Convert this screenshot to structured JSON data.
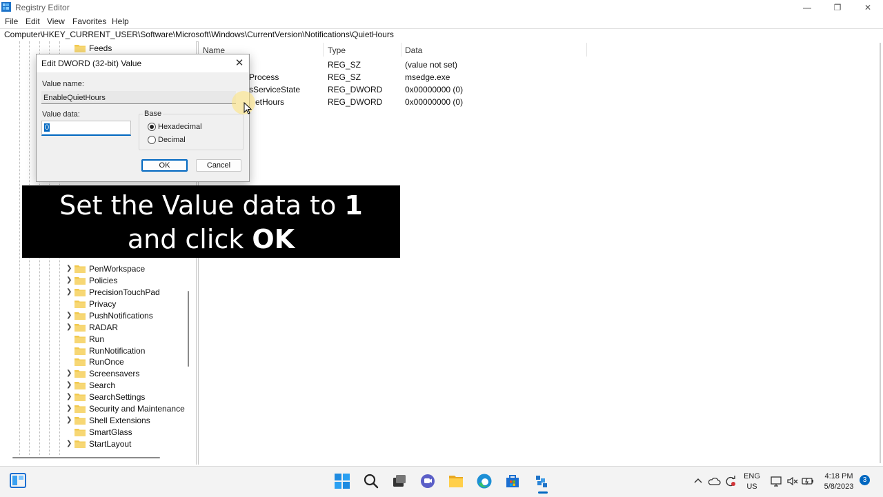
{
  "window": {
    "title": "Registry Editor",
    "controls": {
      "minimize": "—",
      "restore": "❐",
      "close": "✕"
    }
  },
  "menu": [
    "File",
    "Edit",
    "View",
    "Favorites",
    "Help"
  ],
  "address": "Computer\\HKEY_CURRENT_USER\\Software\\Microsoft\\Windows\\CurrentVersion\\Notifications\\QuietHours",
  "tree": {
    "top_item": "Feeds",
    "items": [
      {
        "label": "PenWorkspace",
        "expandable": true
      },
      {
        "label": "Policies",
        "expandable": true
      },
      {
        "label": "PrecisionTouchPad",
        "expandable": true
      },
      {
        "label": "Privacy",
        "expandable": false
      },
      {
        "label": "PushNotifications",
        "expandable": true
      },
      {
        "label": "RADAR",
        "expandable": true
      },
      {
        "label": "Run",
        "expandable": false
      },
      {
        "label": "RunNotification",
        "expandable": false
      },
      {
        "label": "RunOnce",
        "expandable": false
      },
      {
        "label": "Screensavers",
        "expandable": true
      },
      {
        "label": "Search",
        "expandable": true
      },
      {
        "label": "SearchSettings",
        "expandable": true
      },
      {
        "label": "Security and Maintenance",
        "expandable": true
      },
      {
        "label": "Shell Extensions",
        "expandable": true
      },
      {
        "label": "SmartGlass",
        "expandable": false
      },
      {
        "label": "StartLayout",
        "expandable": true
      }
    ]
  },
  "list": {
    "columns": {
      "name": "Name",
      "type": "Type",
      "data": "Data"
    },
    "rows": [
      {
        "name": "",
        "type": "REG_SZ",
        "data": "(value not set)"
      },
      {
        "name": "Process",
        "type": "REG_SZ",
        "data": "msedge.exe"
      },
      {
        "name": "sServiceState",
        "type": "REG_DWORD",
        "data": "0x00000000 (0)"
      },
      {
        "name": "etHours",
        "type": "REG_DWORD",
        "data": "0x00000000 (0)"
      }
    ]
  },
  "dialog": {
    "title": "Edit DWORD (32-bit) Value",
    "close": "✕",
    "value_name_label": "Value name:",
    "value_name": "EnableQuietHours",
    "value_data_label": "Value data:",
    "value_data": "0",
    "base_label": "Base",
    "base_options": [
      {
        "label": "Hexadecimal",
        "selected": true
      },
      {
        "label": "Decimal",
        "selected": false
      }
    ],
    "ok": "OK",
    "cancel": "Cancel"
  },
  "caption": {
    "line1_text": "Set the Value data to ",
    "line1_bold": "1",
    "line2_text": "and click ",
    "line2_bold": "OK"
  },
  "taskbar": {
    "icons": [
      "start-icon",
      "search-icon",
      "task-view-icon",
      "chat-icon",
      "file-explorer-icon",
      "edge-icon",
      "store-icon",
      "regedit-icon"
    ],
    "tray": {
      "lang_top": "ENG",
      "lang_bottom": "US",
      "time": "4:18 PM",
      "date": "5/8/2023",
      "notification_count": "3"
    }
  }
}
